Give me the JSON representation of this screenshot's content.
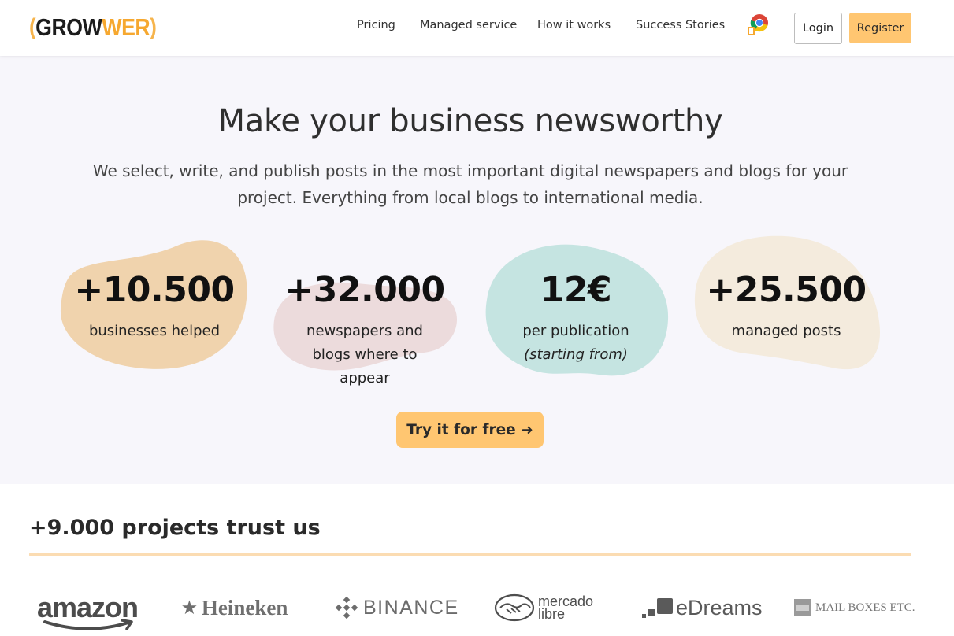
{
  "header": {
    "logo": {
      "open_paren": "(",
      "grow": "GROW",
      "wer": "WER",
      "close_paren": ")"
    },
    "nav": [
      {
        "label": "Pricing"
      },
      {
        "label": "Managed service"
      },
      {
        "label": "How it works"
      },
      {
        "label": "Success Stories"
      }
    ],
    "chrome_icon": "chrome-extension-icon",
    "login_label": "Login",
    "register_label": "Register"
  },
  "hero": {
    "title": "Make your business newsworthy",
    "subtitle_line1": "We select, write, and publish posts in the most important digital newspapers and blogs for your",
    "subtitle_line2": "project. Everything from local blogs to international media.",
    "stats": [
      {
        "number": "+10.500",
        "label": "businesses helped",
        "color": "#f0d3ad"
      },
      {
        "number": "+32.000",
        "label_line1": "newspapers and",
        "label_line2": "blogs where to",
        "label_line3": "appear",
        "color": "#ecdbdc"
      },
      {
        "number": "12€",
        "label": "per publication",
        "note": "(starting from)",
        "color": "#c5e4e1"
      },
      {
        "number": "+25.500",
        "label": "managed posts",
        "color": "#f4ebdd"
      }
    ],
    "cta_label": "Try it for free",
    "cta_arrow": "➜"
  },
  "trust": {
    "title": "+9.000 projects trust us",
    "logos": [
      {
        "name": "amazon"
      },
      {
        "name": "Heineken",
        "star": "★"
      },
      {
        "name": "BINANCE"
      },
      {
        "line1": "mercado",
        "line2": "libre"
      },
      {
        "name": "eDreams"
      },
      {
        "name": "MAIL BOXES ETC."
      }
    ]
  },
  "colors": {
    "accent": "#ffc671",
    "logo_orange": "#f6a830",
    "hero_bg": "#f7f6fb",
    "trust_line": "#fbdcb2"
  }
}
